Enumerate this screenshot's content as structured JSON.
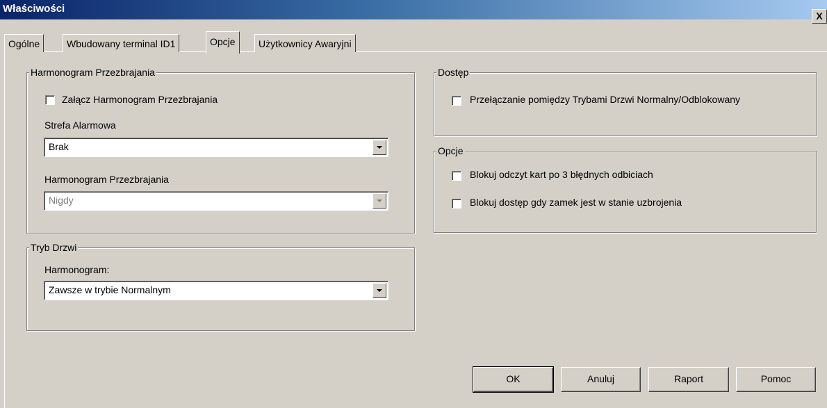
{
  "window": {
    "title": "Właściwości",
    "close_label": "X"
  },
  "tabs": [
    {
      "label": "Ogólne"
    },
    {
      "label": "Wbudowany terminal ID1"
    },
    {
      "label": "Opcje",
      "active": true
    },
    {
      "label": "Użytkownicy Awaryjni"
    }
  ],
  "arming_schedule": {
    "legend": "Harmonogram Przezbrajania",
    "enable_label": "Załącz Harmonogram Przezbrajania",
    "enable_checked": false,
    "zone_label": "Strefa Alarmowa",
    "zone_value": "Brak",
    "schedule_label": "Harmonogram Przezbrajania",
    "schedule_value": "Nigdy"
  },
  "door_mode": {
    "legend": "Tryb Drzwi",
    "schedule_label": "Harmonogram:",
    "schedule_value": "Zawsze w trybie Normalnym"
  },
  "access": {
    "legend": "Dostęp",
    "toggle_label": "Przełączanie pomiędzy Trybami Drzwi Normalny/Odblokowany",
    "toggle_checked": false
  },
  "options": {
    "legend": "Opcje",
    "block_reading_label": "Blokuj odczyt kart po 3 błędnych odbiciach",
    "block_reading_checked": false,
    "block_armed_label": "Blokuj dostęp gdy zamek jest w stanie uzbrojenia",
    "block_armed_checked": false
  },
  "buttons": {
    "ok": "OK",
    "cancel": "Anuluj",
    "report": "Raport",
    "help": "Pomoc"
  }
}
